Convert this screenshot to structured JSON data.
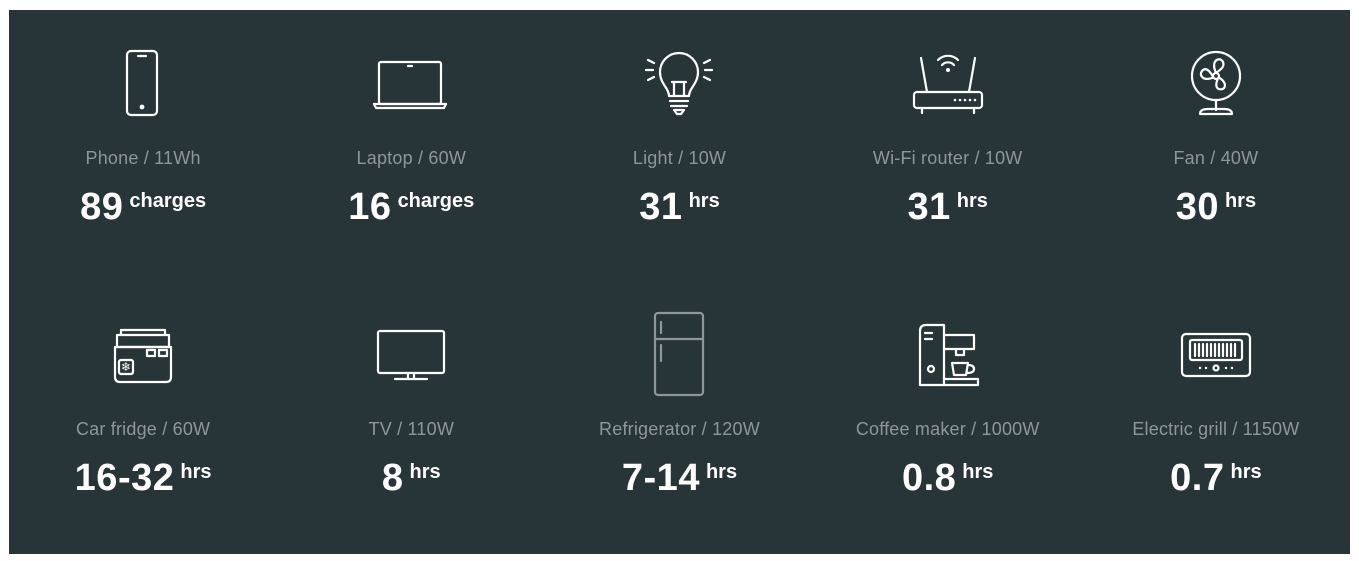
{
  "items": [
    {
      "label": "Phone / 11Wh",
      "value": "89",
      "unit": "charges",
      "icon": "phone-icon"
    },
    {
      "label": "Laptop / 60W",
      "value": "16",
      "unit": "charges",
      "icon": "laptop-icon"
    },
    {
      "label": "Light  / 10W",
      "value": "31",
      "unit": "hrs",
      "icon": "light-bulb-icon"
    },
    {
      "label": "Wi-Fi router / 10W",
      "value": "31",
      "unit": "hrs",
      "icon": "wifi-router-icon"
    },
    {
      "label": "Fan / 40W",
      "value": "30",
      "unit": "hrs",
      "icon": "fan-icon"
    },
    {
      "label": "Car fridge / 60W",
      "value": "16-32",
      "unit": "hrs",
      "icon": "car-fridge-icon"
    },
    {
      "label": "TV / 110W",
      "value": "8",
      "unit": "hrs",
      "icon": "tv-icon"
    },
    {
      "label": "Refrigerator / 120W",
      "value": "7-14",
      "unit": "hrs",
      "icon": "refrigerator-icon"
    },
    {
      "label": "Coffee maker / 1000W",
      "value": "0.8",
      "unit": "hrs",
      "icon": "coffee-maker-icon"
    },
    {
      "label": "Electric grill  / 1150W",
      "value": "0.7",
      "unit": "hrs",
      "icon": "electric-grill-icon"
    }
  ],
  "colors": {
    "background": "#283538",
    "label": "#8f9698",
    "value": "#ffffff"
  }
}
